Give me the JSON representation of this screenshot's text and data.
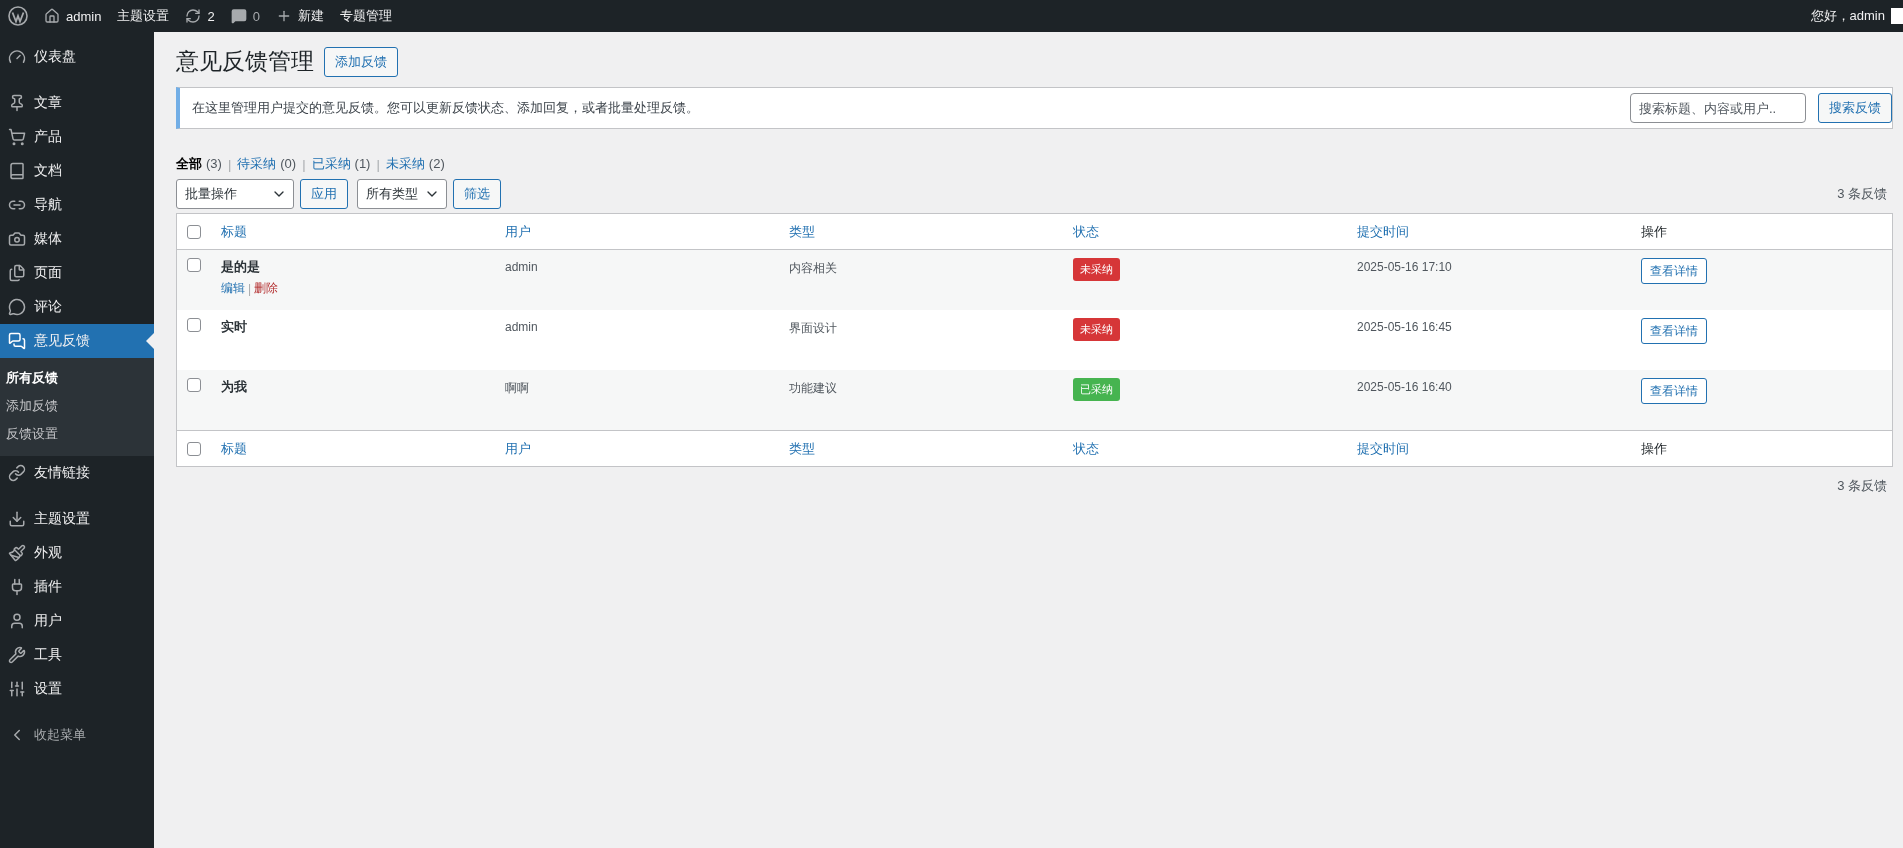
{
  "admin_bar": {
    "site": "admin",
    "theme_settings": "主题设置",
    "updates": "2",
    "comments": "0",
    "new": "新建",
    "topics": "专题管理",
    "greeting": "您好，admin"
  },
  "sidebar": {
    "groups": [
      [
        {
          "label": "仪表盘",
          "selected": false
        }
      ],
      [
        {
          "label": "文章",
          "selected": false
        },
        {
          "label": "产品",
          "selected": false
        },
        {
          "label": "文档",
          "selected": false
        },
        {
          "label": "导航",
          "selected": false
        },
        {
          "label": "媒体",
          "selected": false
        },
        {
          "label": "页面",
          "selected": false
        },
        {
          "label": "评论",
          "selected": false
        },
        {
          "label": "意见反馈",
          "selected": true,
          "children": [
            {
              "label": "所有反馈",
              "selected": true
            },
            {
              "label": "添加反馈",
              "selected": false
            },
            {
              "label": "反馈设置",
              "selected": false
            }
          ]
        },
        {
          "label": "友情链接",
          "selected": false
        }
      ],
      [
        {
          "label": "主题设置",
          "selected": false
        },
        {
          "label": "外观",
          "selected": false
        },
        {
          "label": "插件",
          "selected": false
        },
        {
          "label": "用户",
          "selected": false
        },
        {
          "label": "工具",
          "selected": false
        },
        {
          "label": "设置",
          "selected": false
        }
      ]
    ],
    "collapse": "收起菜单"
  },
  "page": {
    "title": "意见反馈管理",
    "add_button": "添加反馈"
  },
  "notice": {
    "text": "在这里管理用户提交的意见反馈。您可以更新反馈状态、添加回复，或者批量处理反馈。",
    "search": {
      "placeholder": "搜索标题、内容或用户.."
    },
    "search_button": "搜索反馈"
  },
  "views": [
    {
      "label": "全部",
      "count": "(3)",
      "selected": true
    },
    {
      "separator": "|",
      "label": "待采纳",
      "count": "(0)",
      "selected": false
    },
    {
      "separator": "|",
      "label": "已采纳",
      "count": "(1)",
      "selected": false
    },
    {
      "separator": "|",
      "label": "未采纳",
      "count": "(2)",
      "selected": false
    }
  ],
  "bulk_action": {
    "value": "批量操作"
  },
  "apply_button": "应用",
  "type_filter": {
    "value": "所有类型"
  },
  "filter_button": "筛选",
  "count_top": "3 条反馈",
  "table": {
    "select_all_checked": false,
    "footer_select_all_checked": false,
    "columns": [
      {
        "label": "标题",
        "sortable": true
      },
      {
        "label": "用户",
        "sortable": true
      },
      {
        "label": "类型",
        "sortable": true
      },
      {
        "label": "状态",
        "sortable": true
      },
      {
        "label": "提交时间",
        "sortable": true
      },
      {
        "label": "操作",
        "sortable": false
      }
    ],
    "rows": [
      {
        "checked": false,
        "title": "是的是",
        "actions": [
          {
            "label": "编辑",
            "kind": "edit"
          },
          {
            "separator": "|",
            "label": "删除",
            "kind": "delete"
          }
        ],
        "user": "admin",
        "type": "内容相关",
        "status": {
          "label": "未采纳",
          "color": "#d63638"
        },
        "time": "2025-05-16 17:10",
        "view_button": "查看详情"
      },
      {
        "checked": false,
        "title": "实时",
        "user": "admin",
        "type": "界面设计",
        "status": {
          "label": "未采纳",
          "color": "#d63638"
        },
        "time": "2025-05-16 16:45",
        "view_button": "查看详情"
      },
      {
        "checked": false,
        "title": "为我",
        "user": "啊啊",
        "type": "功能建议",
        "status": {
          "label": "已采纳",
          "color": "#46b450"
        },
        "time": "2025-05-16 16:40",
        "view_button": "查看详情"
      }
    ],
    "footer_columns": [
      {
        "label": "标题",
        "sortable": true
      },
      {
        "label": "用户",
        "sortable": true
      },
      {
        "label": "类型",
        "sortable": true
      },
      {
        "label": "状态",
        "sortable": true
      },
      {
        "label": "提交时间",
        "sortable": true
      },
      {
        "label": "操作",
        "sortable": false
      }
    ]
  },
  "count_bottom": "3 条反馈"
}
